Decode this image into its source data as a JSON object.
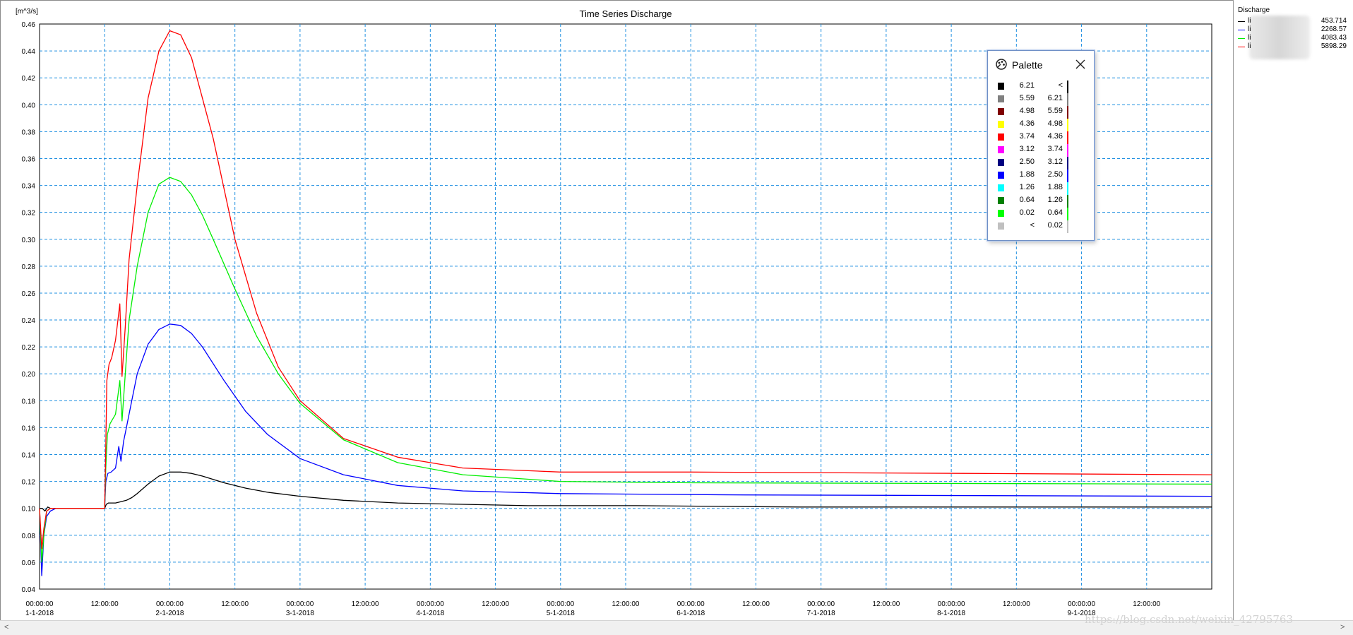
{
  "chart_data": {
    "type": "line",
    "title": "Time Series Discharge",
    "ylabel": "[m^3/s]",
    "xlabel": "",
    "ylim": [
      0.04,
      0.46
    ],
    "xlim_hours": [
      0,
      216
    ],
    "y_ticks": [
      "0.04",
      "0.06",
      "0.08",
      "0.10",
      "0.12",
      "0.14",
      "0.16",
      "0.18",
      "0.20",
      "0.22",
      "0.24",
      "0.26",
      "0.28",
      "0.30",
      "0.32",
      "0.34",
      "0.36",
      "0.38",
      "0.40",
      "0.42",
      "0.44",
      "0.46"
    ],
    "x_ticks": [
      {
        "time": "00:00:00",
        "date": "1-1-2018"
      },
      {
        "time": "12:00:00",
        "date": ""
      },
      {
        "time": "00:00:00",
        "date": "2-1-2018"
      },
      {
        "time": "12:00:00",
        "date": ""
      },
      {
        "time": "00:00:00",
        "date": "3-1-2018"
      },
      {
        "time": "12:00:00",
        "date": ""
      },
      {
        "time": "00:00:00",
        "date": "4-1-2018"
      },
      {
        "time": "12:00:00",
        "date": ""
      },
      {
        "time": "00:00:00",
        "date": "5-1-2018"
      },
      {
        "time": "12:00:00",
        "date": ""
      },
      {
        "time": "00:00:00",
        "date": "6-1-2018"
      },
      {
        "time": "12:00:00",
        "date": ""
      },
      {
        "time": "00:00:00",
        "date": "7-1-2018"
      },
      {
        "time": "12:00:00",
        "date": ""
      },
      {
        "time": "00:00:00",
        "date": "8-1-2018"
      },
      {
        "time": "12:00:00",
        "date": ""
      },
      {
        "time": "00:00:00",
        "date": "9-1-2018"
      },
      {
        "time": "12:00:00",
        "date": ""
      }
    ],
    "grid": true,
    "legend_position": "right",
    "series": [
      {
        "color": "#000000",
        "x": [
          0,
          0.5,
          1,
          1.5,
          2,
          3,
          12,
          12.3,
          12.7,
          14,
          15,
          16,
          17,
          18,
          20,
          22,
          24,
          26,
          28,
          30,
          34,
          38,
          42,
          48,
          56,
          66,
          78,
          90,
          110,
          140,
          216
        ],
        "y": [
          0.1,
          0.1,
          0.098,
          0.101,
          0.1,
          0.1,
          0.1,
          0.103,
          0.104,
          0.104,
          0.105,
          0.106,
          0.108,
          0.111,
          0.118,
          0.124,
          0.127,
          0.127,
          0.126,
          0.124,
          0.119,
          0.115,
          0.112,
          0.109,
          0.106,
          0.104,
          0.103,
          0.102,
          0.102,
          0.101,
          0.101
        ]
      },
      {
        "color": "#0000ff",
        "x": [
          0,
          0.4,
          0.8,
          1.3,
          2,
          3,
          12,
          12.2,
          12.6,
          13.2,
          14,
          14.6,
          15,
          15.5,
          16,
          17,
          18,
          20,
          22,
          24,
          26,
          28,
          30,
          34,
          38,
          42,
          48,
          56,
          66,
          78,
          96,
          130,
          216
        ],
        "y": [
          0.1,
          0.05,
          0.08,
          0.094,
          0.098,
          0.1,
          0.1,
          0.12,
          0.126,
          0.127,
          0.13,
          0.146,
          0.135,
          0.15,
          0.16,
          0.18,
          0.2,
          0.222,
          0.233,
          0.237,
          0.236,
          0.23,
          0.22,
          0.195,
          0.172,
          0.155,
          0.137,
          0.125,
          0.117,
          0.113,
          0.111,
          0.11,
          0.109
        ]
      },
      {
        "color": "#00ee00",
        "x": [
          0,
          0.4,
          0.8,
          1.3,
          2,
          3,
          12,
          12.2,
          12.5,
          13,
          14,
          14.8,
          15.2,
          15.8,
          16.5,
          18,
          20,
          22,
          24,
          26,
          28,
          30,
          32,
          36,
          40,
          44,
          48,
          56,
          66,
          78,
          96,
          120,
          216
        ],
        "y": [
          0.1,
          0.06,
          0.08,
          0.098,
          0.1,
          0.1,
          0.1,
          0.13,
          0.155,
          0.163,
          0.17,
          0.195,
          0.165,
          0.2,
          0.24,
          0.28,
          0.32,
          0.341,
          0.346,
          0.343,
          0.333,
          0.318,
          0.3,
          0.263,
          0.228,
          0.2,
          0.178,
          0.151,
          0.134,
          0.125,
          0.12,
          0.119,
          0.118
        ]
      },
      {
        "color": "#ff0000",
        "x": [
          0,
          0.4,
          0.8,
          1.3,
          2,
          3,
          12,
          12.2,
          12.4,
          12.8,
          13.3,
          14,
          14.8,
          15.2,
          15.8,
          16.5,
          18,
          20,
          22,
          24,
          26,
          28,
          30,
          32,
          36,
          40,
          44,
          48,
          56,
          66,
          78,
          96,
          120,
          170,
          216
        ],
        "y": [
          0.1,
          0.07,
          0.085,
          0.098,
          0.1,
          0.1,
          0.1,
          0.145,
          0.195,
          0.207,
          0.212,
          0.225,
          0.252,
          0.198,
          0.235,
          0.285,
          0.34,
          0.405,
          0.44,
          0.455,
          0.452,
          0.435,
          0.405,
          0.375,
          0.3,
          0.245,
          0.205,
          0.18,
          0.152,
          0.138,
          0.13,
          0.127,
          0.127,
          0.126,
          0.125
        ]
      }
    ]
  },
  "legend": {
    "title": "Discharge",
    "items": [
      {
        "name": "li",
        "color": "#000000",
        "value": "453.714"
      },
      {
        "name": "li",
        "color": "#0000ff",
        "value": "2268.57"
      },
      {
        "name": "li",
        "color": "#00ee00",
        "value": "4083.43"
      },
      {
        "name": "li",
        "color": "#ff0000",
        "value": "5898.29"
      }
    ]
  },
  "palette": {
    "title": "Palette",
    "rows": [
      {
        "color": "#000000",
        "from": "6.21",
        "to": "<"
      },
      {
        "color": "#808080",
        "from": "5.59",
        "to": "6.21"
      },
      {
        "color": "#800000",
        "from": "4.98",
        "to": "5.59"
      },
      {
        "color": "#ffff00",
        "from": "4.36",
        "to": "4.98"
      },
      {
        "color": "#ff0000",
        "from": "3.74",
        "to": "4.36"
      },
      {
        "color": "#ff00ff",
        "from": "3.12",
        "to": "3.74"
      },
      {
        "color": "#000080",
        "from": "2.50",
        "to": "3.12"
      },
      {
        "color": "#0000ff",
        "from": "1.88",
        "to": "2.50"
      },
      {
        "color": "#00ffff",
        "from": "1.26",
        "to": "1.88"
      },
      {
        "color": "#008000",
        "from": "0.64",
        "to": "1.26"
      },
      {
        "color": "#00ff00",
        "from": "0.02",
        "to": "0.64"
      },
      {
        "color": "#c0c0c0",
        "from": "<",
        "to": "0.02"
      }
    ]
  },
  "scrollbar": {
    "left_arrow": "<",
    "right_arrow": ">"
  },
  "watermark": "https://blog.csdn.net/weixin_42795763"
}
